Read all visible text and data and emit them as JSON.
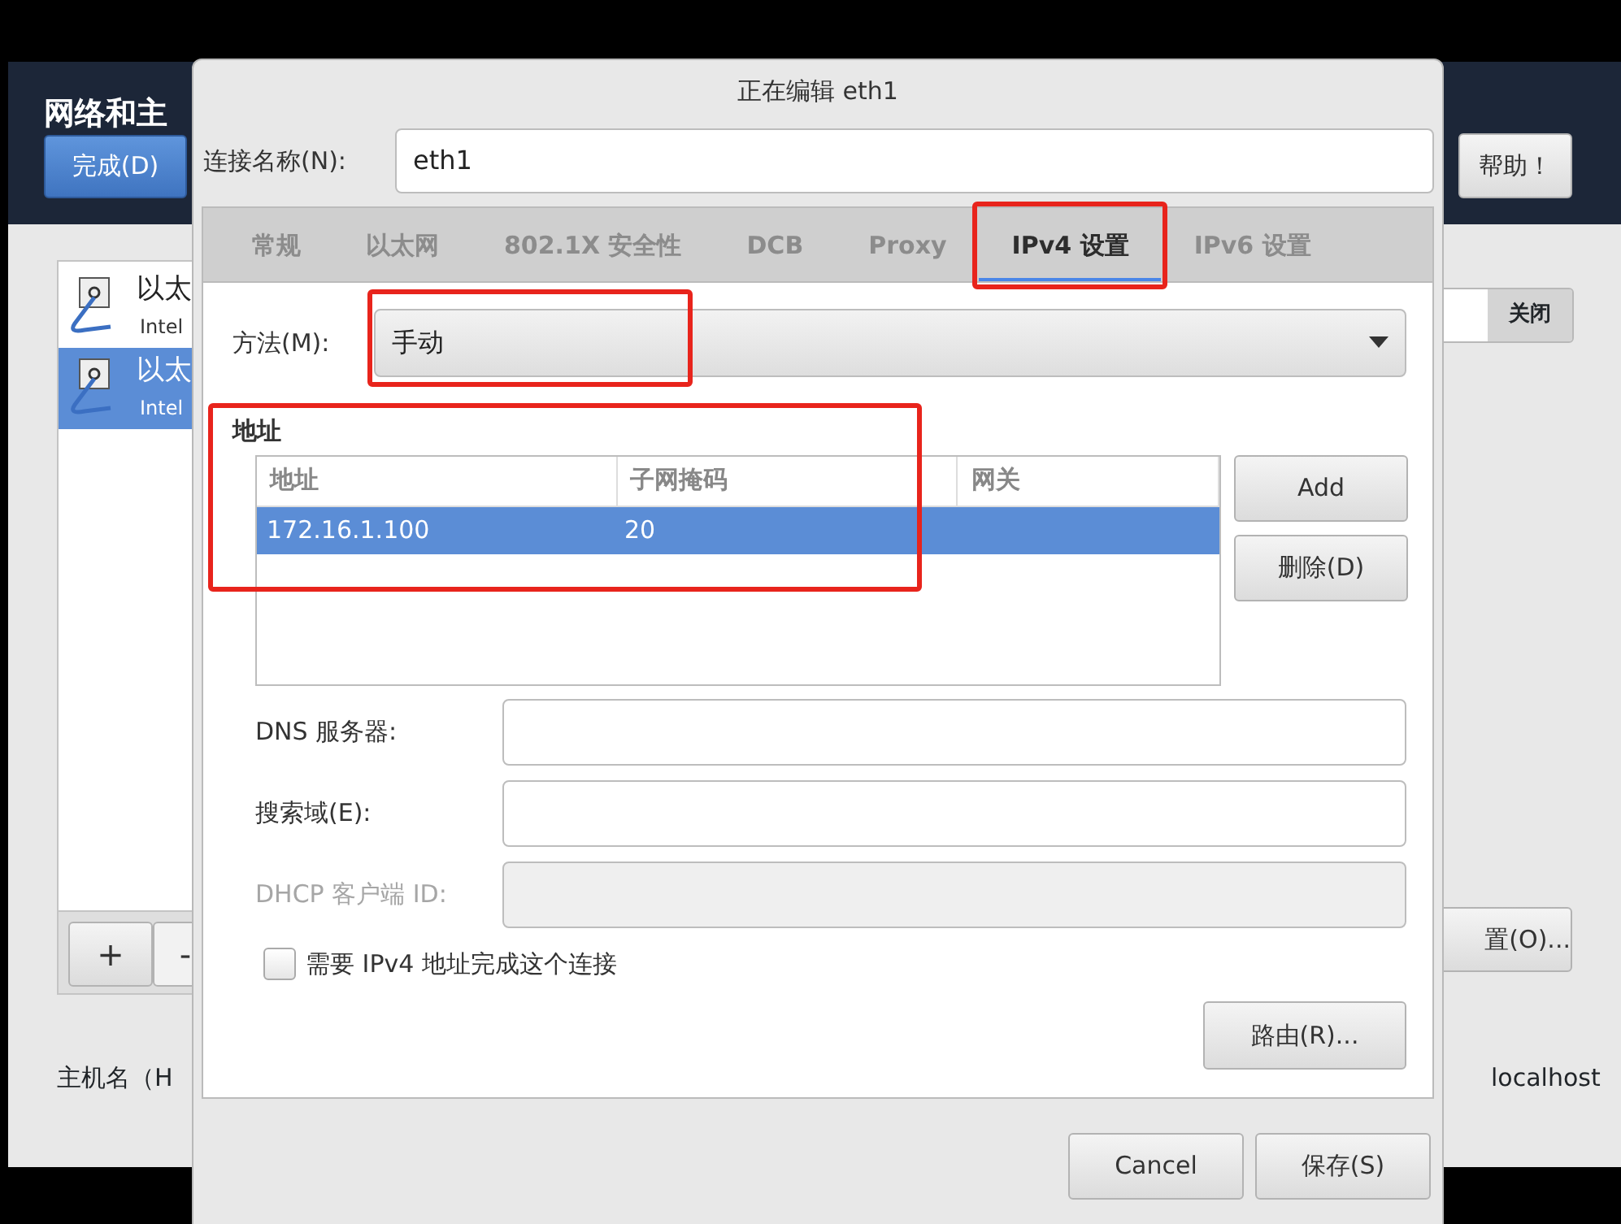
{
  "background_window": {
    "title": "网络和主",
    "done_button": "完成(D)",
    "help_button": "帮助！",
    "connections": [
      {
        "name": "以太",
        "device": "Intel",
        "selected": false
      },
      {
        "name": "以太",
        "device": "Intel",
        "selected": true
      }
    ],
    "add_button": "+",
    "remove_button": "-",
    "switch": {
      "label": "关闭",
      "on": false
    },
    "configure_button": "置(O)...",
    "hostname_label": "主机名（H",
    "hostname": "localhost"
  },
  "dialog": {
    "title": "正在编辑 eth1",
    "connection_name_label": "连接名称(N):",
    "connection_name": "eth1",
    "tabs": [
      {
        "label": "常规",
        "selected": false,
        "highlighted": false
      },
      {
        "label": "以太网",
        "selected": false,
        "highlighted": false
      },
      {
        "label": "802.1X 安全性",
        "selected": false,
        "highlighted": false
      },
      {
        "label": "DCB",
        "selected": false,
        "highlighted": false
      },
      {
        "label": "Proxy",
        "selected": false,
        "highlighted": false
      },
      {
        "label": "IPv4 设置",
        "selected": true,
        "highlighted": true
      },
      {
        "label": "IPv6 设置",
        "selected": false,
        "highlighted": false
      }
    ],
    "method": {
      "label": "方法(M):",
      "value": "手动",
      "highlighted": true
    },
    "addresses": {
      "label": "地址",
      "highlighted": true,
      "columns": [
        "地址",
        "子网掩码",
        "网关"
      ],
      "rows": [
        {
          "address": "172.16.1.100",
          "netmask": "20",
          "selected": true
        }
      ],
      "add_button": "Add",
      "delete_button": "删除(D)"
    },
    "fields": [
      {
        "label": "DNS 服务器:",
        "disabled": false
      },
      {
        "label": "搜索域(E):",
        "disabled": false
      },
      {
        "label": "DHCP 客户端 ID:",
        "disabled": true
      }
    ],
    "require_ipv4": {
      "label": "需要 IPv4 地址完成这个连接",
      "checked": false
    },
    "routes_button": "路由(R)...",
    "buttons": [
      "Cancel",
      "保存(S)"
    ]
  }
}
